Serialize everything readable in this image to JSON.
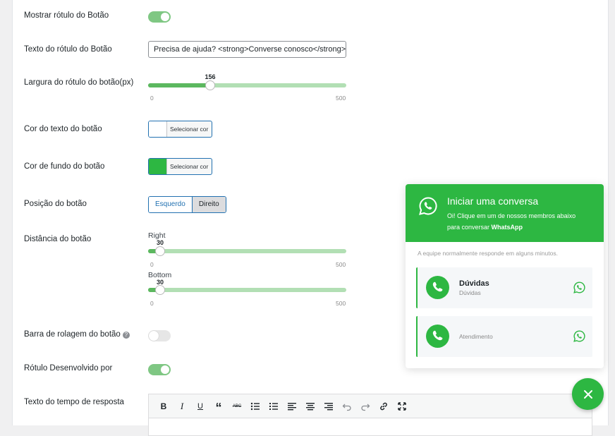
{
  "form": {
    "show_label": {
      "label": "Mostrar rótulo do Botão",
      "on": true
    },
    "label_text": {
      "label": "Texto do rótulo do Botão",
      "value": "Precisa de ajuda? <strong>Converse conosco</strong>"
    },
    "label_width": {
      "label": "Largura do rótulo do botão(px)",
      "value": "156",
      "min": "0",
      "max": "500",
      "fraction": 0.312
    },
    "text_color": {
      "label": "Cor do texto do botão",
      "button": "Selecionar cor",
      "swatch": "#ffffff"
    },
    "bg_color": {
      "label": "Cor de fundo do botão",
      "button": "Selecionar cor",
      "swatch": "#2db742"
    },
    "position": {
      "label": "Posição do botão",
      "options": [
        "Esquerdo",
        "Direito"
      ],
      "selected": "Direito"
    },
    "distance": {
      "label": "Distância do botão",
      "right": {
        "caption": "Right",
        "value": "30",
        "min": "0",
        "max": "500",
        "fraction": 0.06
      },
      "bottom": {
        "caption": "Bottom",
        "value": "30",
        "min": "0",
        "max": "500",
        "fraction": 0.06
      }
    },
    "scroll_bar": {
      "label": "Barra de rolagem do botão",
      "help": "?",
      "on": false
    },
    "powered_by": {
      "label": "Rótulo Desenvolvido por",
      "on": true
    },
    "response_time": {
      "label": "Texto do tempo de resposta"
    }
  },
  "editor_toolbar": [
    {
      "name": "bold",
      "glyph": "B"
    },
    {
      "name": "italic",
      "glyph": "I"
    },
    {
      "name": "underline",
      "glyph": "U"
    },
    {
      "name": "blockquote",
      "glyph": "“"
    },
    {
      "name": "strikethrough",
      "glyph": "ABC"
    },
    {
      "name": "bullet-list-icon"
    },
    {
      "name": "numbered-list-icon"
    },
    {
      "name": "align-left-icon"
    },
    {
      "name": "align-center-icon"
    },
    {
      "name": "align-right-icon"
    },
    {
      "name": "undo-icon"
    },
    {
      "name": "redo-icon"
    },
    {
      "name": "link-icon"
    },
    {
      "name": "fullscreen-icon"
    }
  ],
  "widget": {
    "title": "Iniciar uma conversa",
    "desc_prefix": "Oi! Clique em um de nossos membros abaixo para conversar ",
    "desc_brand": "WhatsApp",
    "note": "A equipe normalmente responde em alguns minutos.",
    "agents": [
      {
        "name": "Dúvidas",
        "subtitle": "Dúvidas"
      },
      {
        "name": "",
        "subtitle": "Atendimento"
      }
    ],
    "accent": "#2db742"
  }
}
